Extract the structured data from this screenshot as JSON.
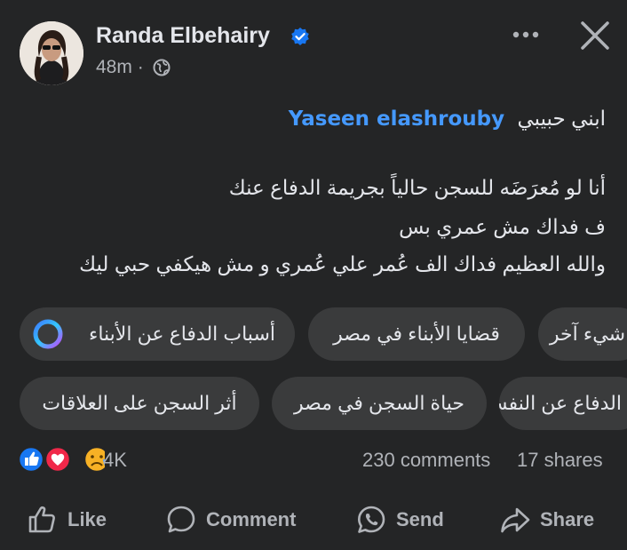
{
  "post": {
    "author": "Randa Elbehairy",
    "time": "48m",
    "privacy_icon": "globe-icon",
    "mention": "Yaseen elashrouby",
    "line1_text": "ابني حبيبي",
    "line2": "أنا لو مُعرَضَه للسجن حالياً بجريمة الدفاع عنك",
    "line3": "ف فداك مش عمري بس",
    "line4": "والله العظيم فداك الف عُمر علي عُمري و مش هيكفي حبي ليك"
  },
  "chips": {
    "row1": [
      "أسباب الدفاع عن الأبناء",
      "قضايا الأبناء في مصر",
      "شيء آخر"
    ],
    "row2": [
      "أثر السجن على العلاقات",
      "حياة السجن في مصر",
      "الدفاع عن النفس"
    ]
  },
  "stats": {
    "reactions": "4K",
    "comments": "230 comments",
    "shares": "17 shares"
  },
  "actions": {
    "like": "Like",
    "comment": "Comment",
    "send": "Send",
    "share": "Share"
  },
  "colors": {
    "background": "#242526",
    "mention": "#4599ff",
    "verified": "#1877f2",
    "chip": "#3a3b3c"
  }
}
